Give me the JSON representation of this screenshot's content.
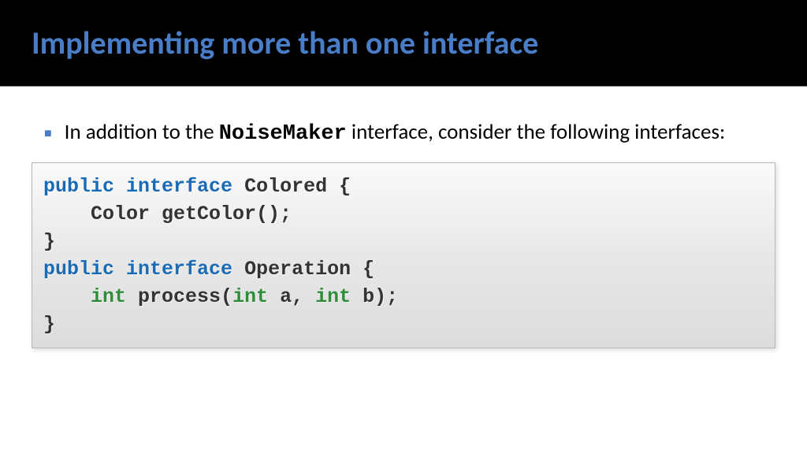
{
  "header": {
    "title": "Implementing more than one interface"
  },
  "content": {
    "bullet_pre": "In addition to the ",
    "bullet_code": "NoiseMaker",
    "bullet_post": " interface, consider the following interfaces:"
  },
  "code": {
    "l1_kw1": "public",
    "l1_kw2": "interface",
    "l1_rest": " Colored {",
    "l2_indent": "    ",
    "l2_text": "Color getColor();",
    "l3_text": "}",
    "l4_text": "",
    "l5_kw1": "public",
    "l5_kw2": "interface",
    "l5_rest": " Operation {",
    "l6_indent": "    ",
    "l6_typ1": "int",
    "l6_mid1": " process(",
    "l6_typ2": "int",
    "l6_mid2": " a, ",
    "l6_typ3": "int",
    "l6_mid3": " b);",
    "l7_text": "}"
  }
}
